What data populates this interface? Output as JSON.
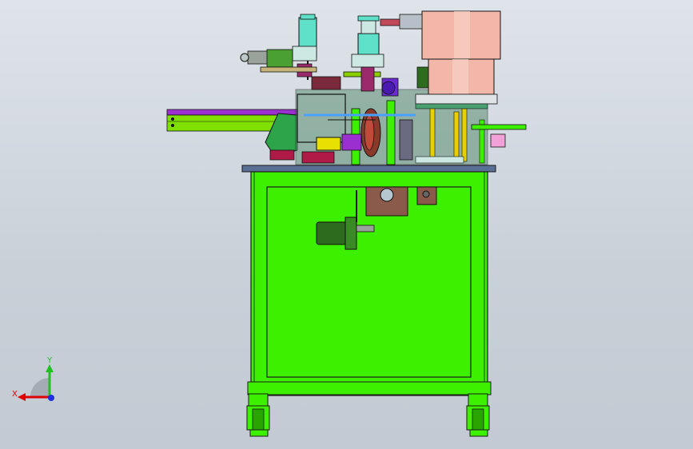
{
  "viewport": {
    "background": "#d4dae1"
  },
  "model": {
    "frame_color": "#3cf000",
    "bowl_color": "#f2b7a8",
    "cylinder_color": "#5fe0c8",
    "rail_purple": "#9b2fd0",
    "motor_color": "#2d6b1e"
  },
  "triad": {
    "x_label": "X",
    "y_label": "Y",
    "x_color": "#e00000",
    "y_color": "#20c020",
    "z_color": "#2030e0"
  }
}
